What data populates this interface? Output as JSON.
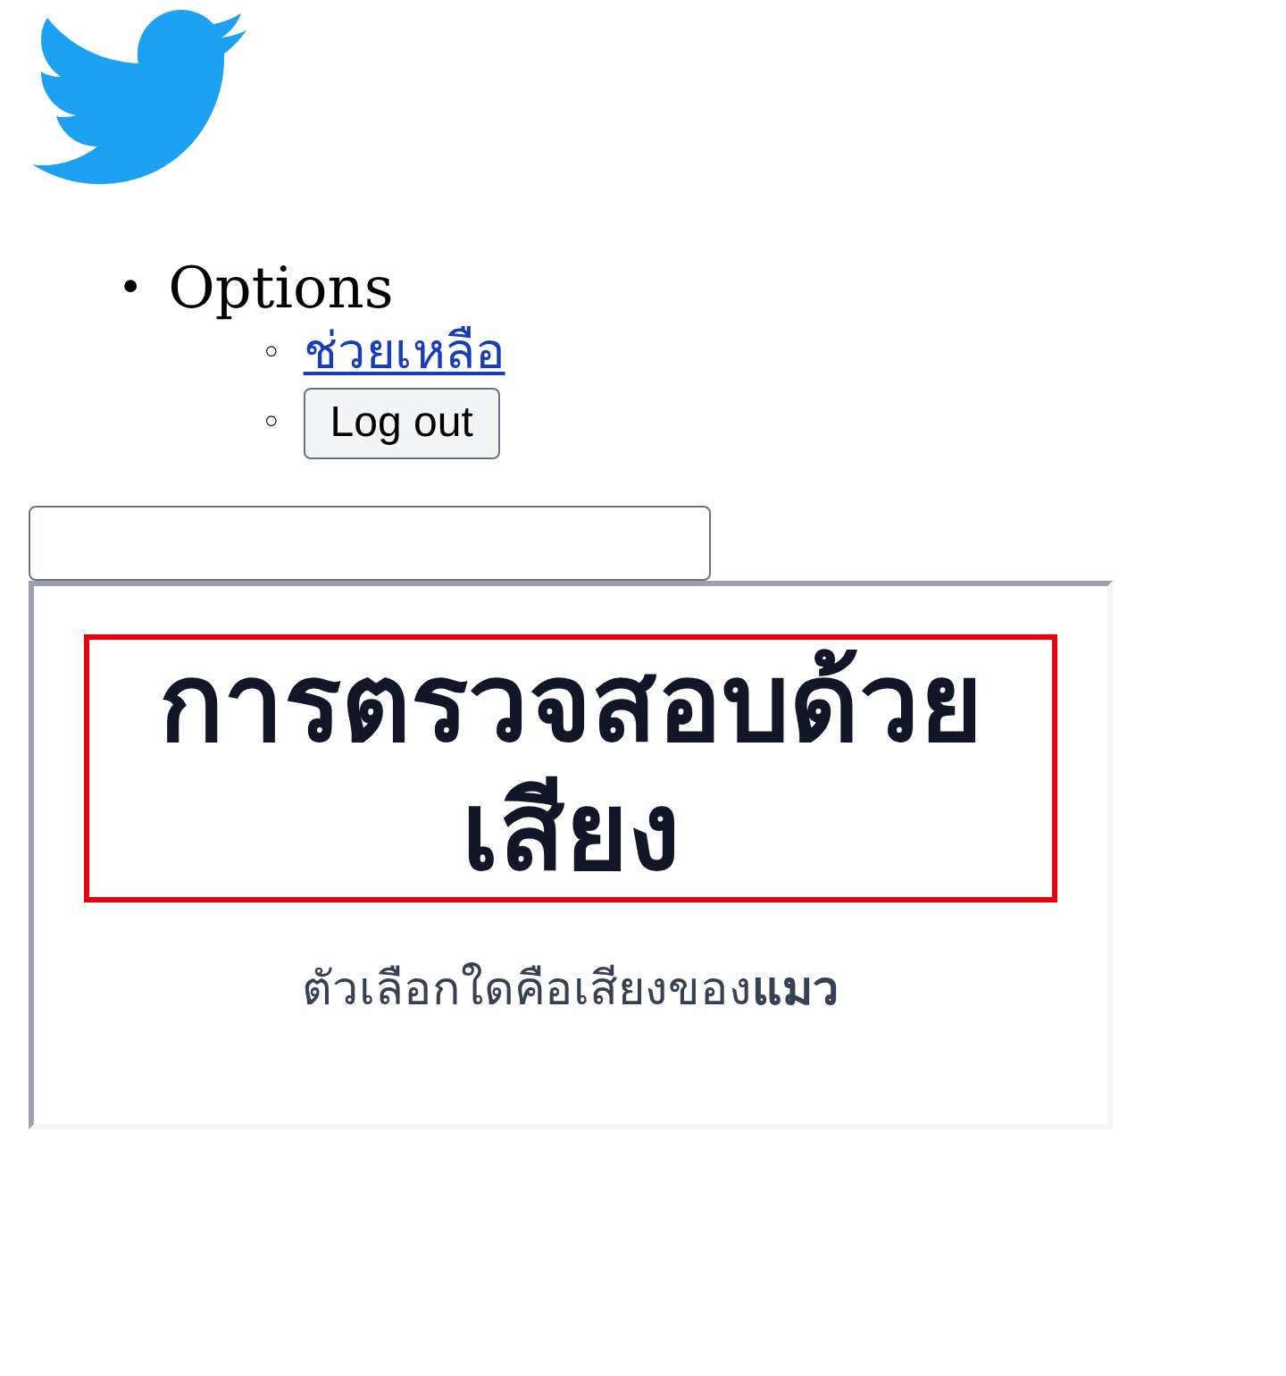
{
  "menu": {
    "marker": "•",
    "label": "Options",
    "items": [
      {
        "kind": "link",
        "marker": "◦",
        "label": "ช่วยเหลือ"
      },
      {
        "kind": "button",
        "marker": "◦",
        "label": "Log out"
      }
    ]
  },
  "challenge": {
    "title": "การตรวจสอบด้วยเสียง",
    "question": "ตัวเลือกใดคือเสียงของ**แมว**"
  }
}
